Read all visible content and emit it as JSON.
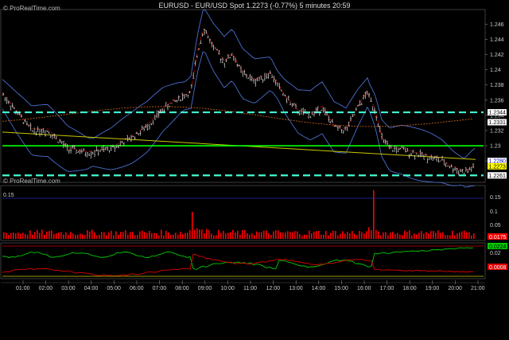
{
  "header": {
    "title": "EURUSD - EUR/USD Spot    1.2273 (-0.77%)    5 minutes  20:59",
    "brand_top": "© ProRealTime.com",
    "brand_bottom": "© ProRealTime.com"
  },
  "price_axis": {
    "ticks": [
      "1.246",
      "1.244",
      "1.242",
      "1.24",
      "1.238",
      "1.236",
      "1.234",
      "1.232",
      "1.23",
      "1.228"
    ],
    "min": 1.2255,
    "max": 1.2475
  },
  "tags": [
    {
      "label": "1.2344",
      "value": 1.2344,
      "bg": "#ffffff",
      "fg": "#000000"
    },
    {
      "label": "1.2331",
      "value": 1.2331,
      "bg": "#ffffff",
      "fg": "#000000"
    },
    {
      "label": "1.2280",
      "value": 1.228,
      "bg": "#ffffff",
      "fg": "#0000cc"
    },
    {
      "label": "1.2273",
      "value": 1.2273,
      "bg": "#ffff00",
      "fg": "#000000"
    },
    {
      "label": "1.2261",
      "value": 1.2261,
      "bg": "#ffffff",
      "fg": "#000000"
    }
  ],
  "levels": {
    "dashed_upper": 1.2344,
    "dashed_lower": 1.2261,
    "solid_green": 1.23,
    "colors": {
      "dashed": "#40ffd0",
      "green": "#00ff00",
      "bollinger": "#4a6fd0",
      "trend": "#c8c800",
      "ma": "#c06018",
      "ma_red": "#d00000"
    }
  },
  "volume_panel": {
    "axis_ticks": [
      "0.15",
      "0.1",
      "0.05"
    ],
    "ref_label": "0.15",
    "value_tag": "0.0175",
    "bar_color": "#ff0000"
  },
  "osc_panel": {
    "axis_ticks": [
      "0.02"
    ],
    "tag_green": "0.0224",
    "tag_red": "0.0008",
    "colors": {
      "green": "#00cc00",
      "red": "#dd0000"
    }
  },
  "time_axis": [
    "01:00",
    "02:00",
    "03:00",
    "04:00",
    "05:00",
    "06:00",
    "07:00",
    "08:00",
    "09:00",
    "10:00",
    "11:00",
    "12:00",
    "13:00",
    "14:00",
    "15:00",
    "16:00",
    "17:00",
    "18:00",
    "19:00",
    "20:00",
    "21:00"
  ]
}
